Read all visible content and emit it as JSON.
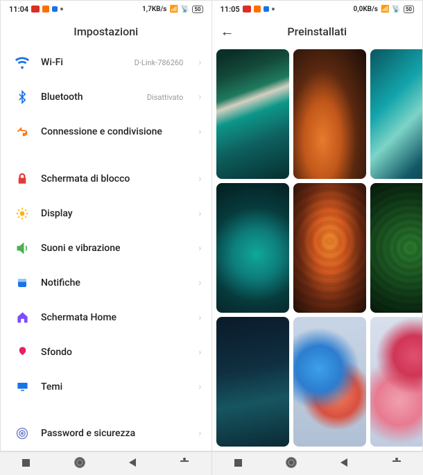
{
  "left_phone": {
    "status": {
      "time": "11:04",
      "net": "1,7KB/s",
      "battery": "50"
    },
    "header": {
      "title": "Impostazioni"
    },
    "settings": {
      "wifi": {
        "label": "Wi-Fi",
        "value": "D-Link-786260",
        "icon_color": "#1a73e8"
      },
      "bluetooth": {
        "label": "Bluetooth",
        "value": "Disattivato",
        "icon_color": "#1a73e8"
      },
      "conn": {
        "label": "Connessione e condivisione",
        "value": "",
        "icon_color": "#ff6d00"
      },
      "lock": {
        "label": "Schermata di blocco",
        "value": "",
        "icon_color": "#e53935"
      },
      "display": {
        "label": "Display",
        "value": "",
        "icon_color": "#ffb300"
      },
      "sound": {
        "label": "Suoni e vibrazione",
        "value": "",
        "icon_color": "#4caf50"
      },
      "notif": {
        "label": "Notifiche",
        "value": "",
        "icon_color": "#1a73e8"
      },
      "home": {
        "label": "Schermata Home",
        "value": "",
        "icon_color": "#7c4dff"
      },
      "wallpaper": {
        "label": "Sfondo",
        "value": "",
        "icon_color": "#e91e63"
      },
      "themes": {
        "label": "Temi",
        "value": "",
        "icon_color": "#1a73e8"
      },
      "security": {
        "label": "Password e sicurezza",
        "value": "",
        "icon_color": "#7986cb"
      }
    }
  },
  "right_phone": {
    "status": {
      "time": "11:05",
      "net": "0,0KB/s",
      "battery": "50"
    },
    "header": {
      "title": "Preinstallati"
    },
    "wallpapers": [
      "coast-green-white",
      "orange-crater-dark",
      "teal-waves",
      "aerial-teal-rock",
      "orange-rings",
      "green-terrace",
      "dark-teal-abstract",
      "blue-red-circles",
      "pink-red-circles"
    ]
  },
  "nav_buttons": [
    "recents",
    "home",
    "back",
    "accessibility"
  ]
}
